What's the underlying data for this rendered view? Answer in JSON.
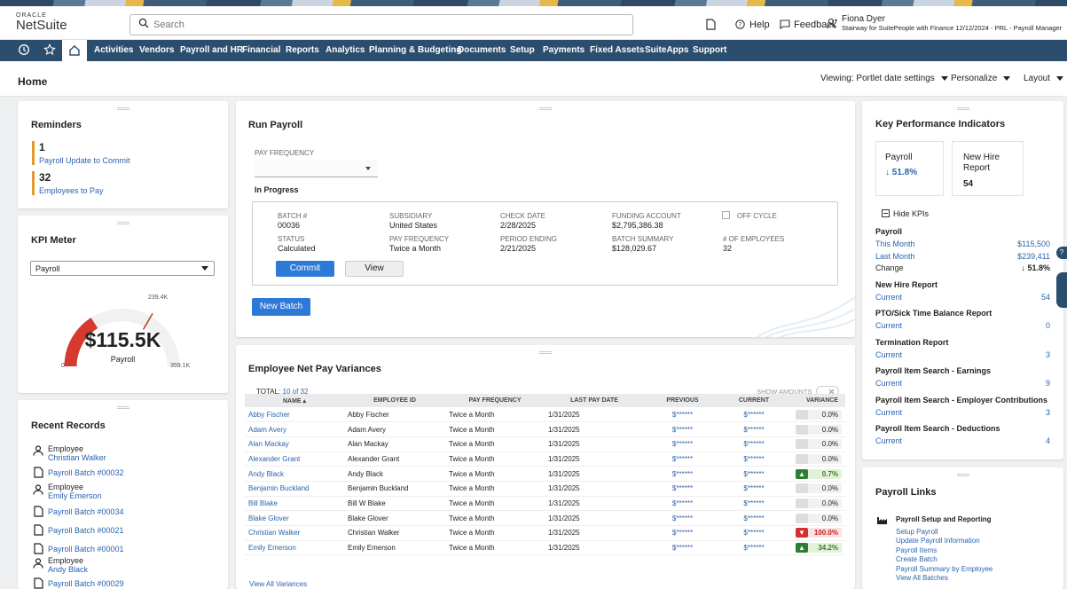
{
  "brand": {
    "oracle": "ORACLE",
    "netsuite": "NetSuite"
  },
  "search": {
    "placeholder": "Search"
  },
  "topbar": {
    "help": "Help",
    "feedback": "Feedback",
    "user_name": "Fiona Dyer",
    "user_role": "Stairway for SuitePeople with Finance 12/12/2024 - PRL - Payroll Manager"
  },
  "nav": [
    "Activities",
    "Vendors",
    "Payroll and HR",
    "Financial",
    "Reports",
    "Analytics",
    "Planning & Budgeting",
    "Documents",
    "Setup",
    "Payments",
    "Fixed Assets",
    "SuiteApps",
    "Support"
  ],
  "page": {
    "title": "Home",
    "viewing": "Viewing: Portlet date settings",
    "personalize": "Personalize",
    "layout": "Layout"
  },
  "reminders": {
    "title": "Reminders",
    "items": [
      {
        "count": "1",
        "label": "Payroll Update to Commit"
      },
      {
        "count": "32",
        "label": "Employees to Pay"
      }
    ]
  },
  "kpi_meter": {
    "title": "KPI Meter",
    "select": "Payroll",
    "value": "$115.5K",
    "label": "Payroll",
    "min": "0",
    "mark": "239.4K",
    "max": "359.1K",
    "level": 0.32,
    "marker": 0.667
  },
  "recent": {
    "title": "Recent Records",
    "items": [
      {
        "type": "person",
        "kind": "Employee",
        "name": "Christian Walker"
      },
      {
        "type": "doc",
        "name": "Payroll Batch #00032"
      },
      {
        "type": "person",
        "kind": "Employee",
        "name": "Emily Emerson"
      },
      {
        "type": "doc",
        "name": "Payroll Batch #00034"
      },
      {
        "type": "doc",
        "name": "Payroll Batch #00021"
      },
      {
        "type": "doc",
        "name": "Payroll Batch #00001"
      },
      {
        "type": "person",
        "kind": "Employee",
        "name": "Andy Black"
      },
      {
        "type": "doc",
        "name": "Payroll Batch #00029"
      }
    ]
  },
  "run_payroll": {
    "title": "Run Payroll",
    "pay_freq_label": "PAY FREQUENCY",
    "in_progress": "In Progress",
    "batch": {
      "batch_label": "BATCH #",
      "batch": "00036",
      "sub_label": "SUBSIDIARY",
      "sub": "United States",
      "check_label": "CHECK DATE",
      "check": "2/28/2025",
      "fund_label": "FUNDING ACCOUNT",
      "fund": "$2,795,386.38",
      "off_cycle": "OFF CYCLE",
      "status_label": "STATUS",
      "status": "Calculated",
      "freq_label": "PAY FREQUENCY",
      "freq": "Twice a Month",
      "period_label": "PERIOD ENDING",
      "period": "2/21/2025",
      "summary_label": "BATCH SUMMARY",
      "summary": "$128,029.67",
      "emp_label": "# OF EMPLOYEES",
      "emp": "32"
    },
    "commit": "Commit",
    "view": "View",
    "new_batch": "New Batch"
  },
  "variances": {
    "title": "Employee Net Pay Variances",
    "total_label": "TOTAL:",
    "total": "10 of 32",
    "show_amounts": "SHOW AMOUNTS",
    "columns": [
      "NAME ▴",
      "EMPLOYEE ID",
      "PAY FREQUENCY",
      "LAST PAY DATE",
      "PREVIOUS",
      "CURRENT",
      "VARIANCE"
    ],
    "rows": [
      {
        "name": "Abby Fischer",
        "id": "Abby Fischer",
        "freq": "Twice a Month",
        "date": "1/31/2025",
        "prev": "$******",
        "cur": "$******",
        "var": "0.0%",
        "dir": "none"
      },
      {
        "name": "Adam Avery",
        "id": "Adam Avery",
        "freq": "Twice a Month",
        "date": "1/31/2025",
        "prev": "$******",
        "cur": "$******",
        "var": "0.0%",
        "dir": "none"
      },
      {
        "name": "Alan Mackay",
        "id": "Alan Mackay",
        "freq": "Twice a Month",
        "date": "1/31/2025",
        "prev": "$******",
        "cur": "$******",
        "var": "0.0%",
        "dir": "none"
      },
      {
        "name": "Alexander Grant",
        "id": "Alexander Grant",
        "freq": "Twice a Month",
        "date": "1/31/2025",
        "prev": "$******",
        "cur": "$******",
        "var": "0.0%",
        "dir": "none"
      },
      {
        "name": "Andy Black",
        "id": "Andy Black",
        "freq": "Twice a Month",
        "date": "1/31/2025",
        "prev": "$******",
        "cur": "$******",
        "var": "0.7%",
        "dir": "up"
      },
      {
        "name": "Benjamin Buckland",
        "id": "Benjamin Buckland",
        "freq": "Twice a Month",
        "date": "1/31/2025",
        "prev": "$******",
        "cur": "$******",
        "var": "0.0%",
        "dir": "none"
      },
      {
        "name": "Bill Blake",
        "id": "Bill W Blake",
        "freq": "Twice a Month",
        "date": "1/31/2025",
        "prev": "$******",
        "cur": "$******",
        "var": "0.0%",
        "dir": "none"
      },
      {
        "name": "Blake Glover",
        "id": "Blake Glover",
        "freq": "Twice a Month",
        "date": "1/31/2025",
        "prev": "$******",
        "cur": "$******",
        "var": "0.0%",
        "dir": "none"
      },
      {
        "name": "Christian Walker",
        "id": "Christian Walker",
        "freq": "Twice a Month",
        "date": "1/31/2025",
        "prev": "$******",
        "cur": "$******",
        "var": "100.0%",
        "dir": "down"
      },
      {
        "name": "Emily Emerson",
        "id": "Emily Emerson",
        "freq": "Twice a Month",
        "date": "1/31/2025",
        "prev": "$******",
        "cur": "$******",
        "var": "34.2%",
        "dir": "up"
      }
    ],
    "view_all": "View All Variances"
  },
  "kpi": {
    "title": "Key Performance Indicators",
    "card1_title": "Payroll",
    "card1_val": "↓ 51.8%",
    "card2_title": "New Hire Report",
    "card2_val": "54",
    "hide": "Hide KPIs",
    "sections": [
      {
        "name": "Payroll",
        "rows": [
          {
            "k": "This Month",
            "v": "$115,500"
          },
          {
            "k": "Last Month",
            "v": "$239,411"
          },
          {
            "k": "Change",
            "v": "↓ 51.8%",
            "dark": true
          }
        ]
      },
      {
        "name": "New Hire Report",
        "rows": [
          {
            "k": "Current",
            "v": "54"
          }
        ]
      },
      {
        "name": "PTO/Sick Time Balance Report",
        "rows": [
          {
            "k": "Current",
            "v": "0"
          }
        ]
      },
      {
        "name": "Termination Report",
        "rows": [
          {
            "k": "Current",
            "v": "3"
          }
        ]
      },
      {
        "name": "Payroll Item Search - Earnings",
        "rows": [
          {
            "k": "Current",
            "v": "9"
          }
        ]
      },
      {
        "name": "Payroll Item Search - Employer Contributions",
        "rows": [
          {
            "k": "Current",
            "v": "3"
          }
        ]
      },
      {
        "name": "Payroll Item Search - Deductions",
        "rows": [
          {
            "k": "Current",
            "v": "4"
          }
        ]
      }
    ]
  },
  "payroll_links": {
    "title": "Payroll Links",
    "group": "Payroll Setup and Reporting",
    "links": [
      "Setup Payroll",
      "Update Payroll Information",
      "Payroll Items",
      "Create Batch",
      "Payroll Summary by Employee",
      "View All Batches"
    ]
  }
}
